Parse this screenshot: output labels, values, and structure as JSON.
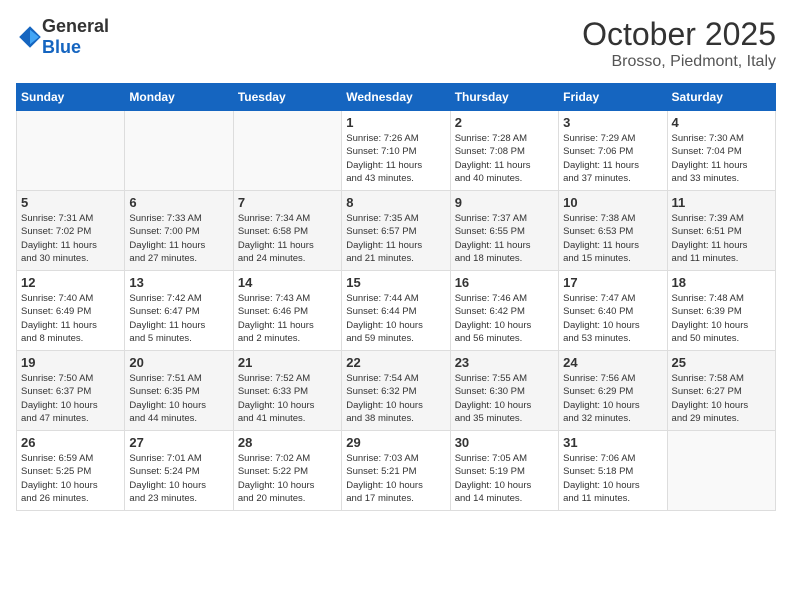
{
  "header": {
    "logo": {
      "general": "General",
      "blue": "Blue"
    },
    "month": "October 2025",
    "location": "Brosso, Piedmont, Italy"
  },
  "weekdays": [
    "Sunday",
    "Monday",
    "Tuesday",
    "Wednesday",
    "Thursday",
    "Friday",
    "Saturday"
  ],
  "weeks": [
    [
      {
        "day": "",
        "info": ""
      },
      {
        "day": "",
        "info": ""
      },
      {
        "day": "",
        "info": ""
      },
      {
        "day": "1",
        "info": "Sunrise: 7:26 AM\nSunset: 7:10 PM\nDaylight: 11 hours\nand 43 minutes."
      },
      {
        "day": "2",
        "info": "Sunrise: 7:28 AM\nSunset: 7:08 PM\nDaylight: 11 hours\nand 40 minutes."
      },
      {
        "day": "3",
        "info": "Sunrise: 7:29 AM\nSunset: 7:06 PM\nDaylight: 11 hours\nand 37 minutes."
      },
      {
        "day": "4",
        "info": "Sunrise: 7:30 AM\nSunset: 7:04 PM\nDaylight: 11 hours\nand 33 minutes."
      }
    ],
    [
      {
        "day": "5",
        "info": "Sunrise: 7:31 AM\nSunset: 7:02 PM\nDaylight: 11 hours\nand 30 minutes."
      },
      {
        "day": "6",
        "info": "Sunrise: 7:33 AM\nSunset: 7:00 PM\nDaylight: 11 hours\nand 27 minutes."
      },
      {
        "day": "7",
        "info": "Sunrise: 7:34 AM\nSunset: 6:58 PM\nDaylight: 11 hours\nand 24 minutes."
      },
      {
        "day": "8",
        "info": "Sunrise: 7:35 AM\nSunset: 6:57 PM\nDaylight: 11 hours\nand 21 minutes."
      },
      {
        "day": "9",
        "info": "Sunrise: 7:37 AM\nSunset: 6:55 PM\nDaylight: 11 hours\nand 18 minutes."
      },
      {
        "day": "10",
        "info": "Sunrise: 7:38 AM\nSunset: 6:53 PM\nDaylight: 11 hours\nand 15 minutes."
      },
      {
        "day": "11",
        "info": "Sunrise: 7:39 AM\nSunset: 6:51 PM\nDaylight: 11 hours\nand 11 minutes."
      }
    ],
    [
      {
        "day": "12",
        "info": "Sunrise: 7:40 AM\nSunset: 6:49 PM\nDaylight: 11 hours\nand 8 minutes."
      },
      {
        "day": "13",
        "info": "Sunrise: 7:42 AM\nSunset: 6:47 PM\nDaylight: 11 hours\nand 5 minutes."
      },
      {
        "day": "14",
        "info": "Sunrise: 7:43 AM\nSunset: 6:46 PM\nDaylight: 11 hours\nand 2 minutes."
      },
      {
        "day": "15",
        "info": "Sunrise: 7:44 AM\nSunset: 6:44 PM\nDaylight: 10 hours\nand 59 minutes."
      },
      {
        "day": "16",
        "info": "Sunrise: 7:46 AM\nSunset: 6:42 PM\nDaylight: 10 hours\nand 56 minutes."
      },
      {
        "day": "17",
        "info": "Sunrise: 7:47 AM\nSunset: 6:40 PM\nDaylight: 10 hours\nand 53 minutes."
      },
      {
        "day": "18",
        "info": "Sunrise: 7:48 AM\nSunset: 6:39 PM\nDaylight: 10 hours\nand 50 minutes."
      }
    ],
    [
      {
        "day": "19",
        "info": "Sunrise: 7:50 AM\nSunset: 6:37 PM\nDaylight: 10 hours\nand 47 minutes."
      },
      {
        "day": "20",
        "info": "Sunrise: 7:51 AM\nSunset: 6:35 PM\nDaylight: 10 hours\nand 44 minutes."
      },
      {
        "day": "21",
        "info": "Sunrise: 7:52 AM\nSunset: 6:33 PM\nDaylight: 10 hours\nand 41 minutes."
      },
      {
        "day": "22",
        "info": "Sunrise: 7:54 AM\nSunset: 6:32 PM\nDaylight: 10 hours\nand 38 minutes."
      },
      {
        "day": "23",
        "info": "Sunrise: 7:55 AM\nSunset: 6:30 PM\nDaylight: 10 hours\nand 35 minutes."
      },
      {
        "day": "24",
        "info": "Sunrise: 7:56 AM\nSunset: 6:29 PM\nDaylight: 10 hours\nand 32 minutes."
      },
      {
        "day": "25",
        "info": "Sunrise: 7:58 AM\nSunset: 6:27 PM\nDaylight: 10 hours\nand 29 minutes."
      }
    ],
    [
      {
        "day": "26",
        "info": "Sunrise: 6:59 AM\nSunset: 5:25 PM\nDaylight: 10 hours\nand 26 minutes."
      },
      {
        "day": "27",
        "info": "Sunrise: 7:01 AM\nSunset: 5:24 PM\nDaylight: 10 hours\nand 23 minutes."
      },
      {
        "day": "28",
        "info": "Sunrise: 7:02 AM\nSunset: 5:22 PM\nDaylight: 10 hours\nand 20 minutes."
      },
      {
        "day": "29",
        "info": "Sunrise: 7:03 AM\nSunset: 5:21 PM\nDaylight: 10 hours\nand 17 minutes."
      },
      {
        "day": "30",
        "info": "Sunrise: 7:05 AM\nSunset: 5:19 PM\nDaylight: 10 hours\nand 14 minutes."
      },
      {
        "day": "31",
        "info": "Sunrise: 7:06 AM\nSunset: 5:18 PM\nDaylight: 10 hours\nand 11 minutes."
      },
      {
        "day": "",
        "info": ""
      }
    ]
  ]
}
